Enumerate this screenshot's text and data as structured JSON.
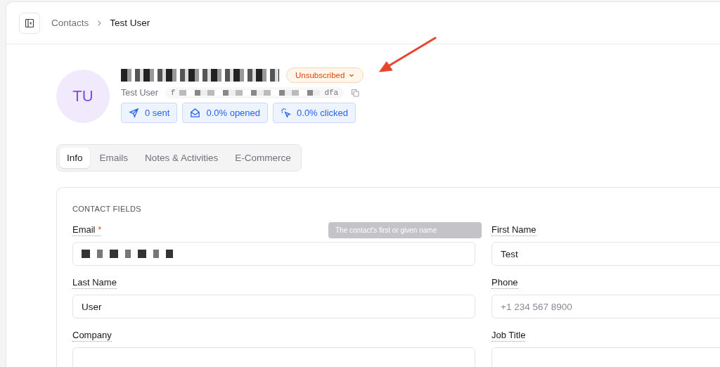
{
  "breadcrumb": {
    "parent": "Contacts",
    "current": "Test User"
  },
  "contact": {
    "initials": "TU",
    "status": "Unsubscribed",
    "name": "Test User",
    "id_start": "f",
    "id_end": "dfa"
  },
  "stats": [
    {
      "kind": "sent",
      "label": "0 sent"
    },
    {
      "kind": "opened",
      "label": "0.0% opened"
    },
    {
      "kind": "clicked",
      "label": "0.0% clicked"
    }
  ],
  "tabs": [
    {
      "label": "Info",
      "selected": true
    },
    {
      "label": "Emails",
      "selected": false
    },
    {
      "label": "Notes & Activities",
      "selected": false
    },
    {
      "label": "E-Commerce",
      "selected": false
    }
  ],
  "section_title": "CONTACT FIELDS",
  "tooltip": "The contact's first or given name",
  "fields": [
    {
      "label": "Email",
      "required_mark": "*",
      "redacted": true
    },
    {
      "label": "First Name",
      "value": "Test",
      "redacted": false
    },
    {
      "label": "Last Name",
      "value": "User",
      "redacted": false
    },
    {
      "label": "Phone",
      "placeholder": "+1 234 567 8900",
      "redacted": false
    },
    {
      "label": "Company",
      "redacted": false
    },
    {
      "label": "Job Title",
      "redacted": false
    }
  ]
}
